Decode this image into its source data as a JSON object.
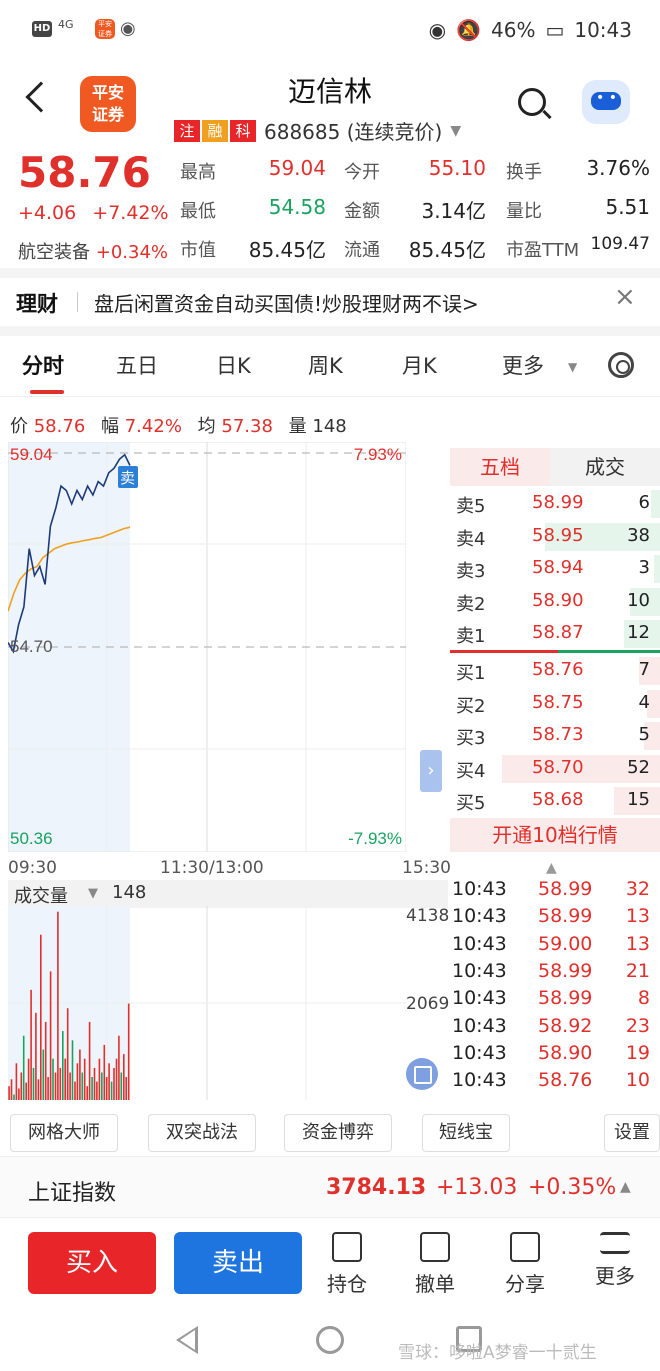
{
  "status": {
    "hd": "HD",
    "signal": "4G",
    "battery": "46%",
    "time": "10:43"
  },
  "header": {
    "logo_text": "平安证券",
    "stock_name": "迈信林",
    "tags": [
      {
        "label": "注",
        "color": "#e8262a"
      },
      {
        "label": "融",
        "color": "#f0a020"
      },
      {
        "label": "科",
        "color": "#e8262a"
      }
    ],
    "code_status": "688685 (连续竞价)"
  },
  "quote": {
    "price": "58.76",
    "change": "+4.06",
    "change_pct": "+7.42%",
    "sector": "航空装备",
    "sector_chg": "+0.34%",
    "rows": [
      [
        {
          "label": "最高",
          "value": "59.04",
          "color": "red"
        },
        {
          "label": "今开",
          "value": "55.10",
          "color": "red"
        },
        {
          "label": "换手",
          "value": "3.76%",
          "color": "black"
        }
      ],
      [
        {
          "label": "最低",
          "value": "54.58",
          "color": "green"
        },
        {
          "label": "金额",
          "value": "3.14亿",
          "color": "black"
        },
        {
          "label": "量比",
          "value": "5.51",
          "color": "black"
        }
      ],
      [
        {
          "label": "市值",
          "value": "85.45亿",
          "color": "black"
        },
        {
          "label": "流通",
          "value": "85.45亿",
          "color": "black"
        },
        {
          "label": "市盈TTM",
          "value": "109.47",
          "color": "black"
        }
      ]
    ]
  },
  "news": {
    "label": "理财",
    "text": "盘后闲置资金自动买国债!炒股理财两不误>",
    "close": "×"
  },
  "tabs": [
    "分时",
    "五日",
    "日K",
    "周K",
    "月K",
    "更多"
  ],
  "info": {
    "price_label": "价",
    "price": "58.76",
    "range_label": "幅",
    "range": "7.42%",
    "avg_label": "均",
    "avg": "57.38",
    "vol_label": "量",
    "vol": "148"
  },
  "chart": {
    "top_price": "59.04",
    "top_pct": "7.93%",
    "mid_price": "54.70",
    "bottom_price": "50.36",
    "bottom_pct": "-7.93%",
    "sell_marker": "卖",
    "times": [
      "09:30",
      "11:30/13:00",
      "15:30"
    ],
    "price_line": [
      54.8,
      54.6,
      55.2,
      55.6,
      56.9,
      56.3,
      56.5,
      56.1,
      57.4,
      57.8,
      58.3,
      58.2,
      57.9,
      58.2,
      58.0,
      58.3,
      58.1,
      58.4,
      58.3,
      58.6,
      58.7,
      58.9,
      59.0,
      58.76
    ],
    "avg_line": [
      54.8,
      55.0,
      55.5,
      55.9,
      56.2,
      56.35,
      56.45,
      56.5,
      56.7,
      56.8,
      56.9,
      56.95,
      57.0,
      57.03,
      57.05,
      57.08,
      57.1,
      57.13,
      57.15,
      57.2,
      57.25,
      57.3,
      57.35,
      57.38
    ],
    "ylim": [
      50.36,
      59.04
    ]
  },
  "orderbook": {
    "tab_active": "五档",
    "tab_other": "成交",
    "asks": [
      {
        "label": "卖5",
        "price": "58.99",
        "vol": "6",
        "frac": 0.06
      },
      {
        "label": "卖4",
        "price": "58.95",
        "vol": "38",
        "frac": 0.73
      },
      {
        "label": "卖3",
        "price": "58.94",
        "vol": "3",
        "frac": 0.03
      },
      {
        "label": "卖2",
        "price": "58.90",
        "vol": "10",
        "frac": 0.19
      },
      {
        "label": "卖1",
        "price": "58.87",
        "vol": "12",
        "frac": 0.23
      }
    ],
    "bids": [
      {
        "label": "买1",
        "price": "58.76",
        "vol": "7",
        "frac": 0.13
      },
      {
        "label": "买2",
        "price": "58.75",
        "vol": "4",
        "frac": 0.08
      },
      {
        "label": "买3",
        "price": "58.73",
        "vol": "5",
        "frac": 0.1
      },
      {
        "label": "买4",
        "price": "58.70",
        "vol": "52",
        "frac": 1.0
      },
      {
        "label": "买5",
        "price": "58.68",
        "vol": "15",
        "frac": 0.29
      }
    ],
    "open10": "开通10档行情"
  },
  "volume": {
    "label": "成交量",
    "value": "148",
    "ticks": [
      "4138",
      "2069"
    ],
    "bars": [
      300,
      450,
      120,
      800,
      250,
      600,
      1400,
      380,
      900,
      2400,
      700,
      1900,
      450,
      3600,
      1100,
      1700,
      500,
      2800,
      900,
      600,
      4100,
      700,
      1500,
      900,
      2000,
      600,
      1300,
      400,
      800,
      1100,
      600,
      900,
      300,
      1700,
      500,
      700,
      400,
      900,
      600,
      1200,
      500,
      800,
      400,
      700,
      900,
      1400,
      600,
      1000,
      500,
      2100
    ]
  },
  "trades": [
    {
      "time": "10:43",
      "price": "58.99",
      "vol": "32"
    },
    {
      "time": "10:43",
      "price": "58.99",
      "vol": "13"
    },
    {
      "time": "10:43",
      "price": "59.00",
      "vol": "13"
    },
    {
      "time": "10:43",
      "price": "58.99",
      "vol": "21"
    },
    {
      "time": "10:43",
      "price": "58.99",
      "vol": "8"
    },
    {
      "time": "10:43",
      "price": "58.92",
      "vol": "23"
    },
    {
      "time": "10:43",
      "price": "58.90",
      "vol": "19"
    },
    {
      "time": "10:43",
      "price": "58.76",
      "vol": "10"
    }
  ],
  "tools": [
    "网格大师",
    "双突战法",
    "资金博弈",
    "短线宝",
    "设置"
  ],
  "index": {
    "name": "上证指数",
    "value": "3784.13",
    "change": "+13.03",
    "pct": "+0.35%"
  },
  "bottom": {
    "buy": "买入",
    "sell": "卖出",
    "nav": [
      "持仓",
      "撤单",
      "分享",
      "更多"
    ]
  },
  "watermark": "雪球：哆啦A梦睿一十贰生"
}
